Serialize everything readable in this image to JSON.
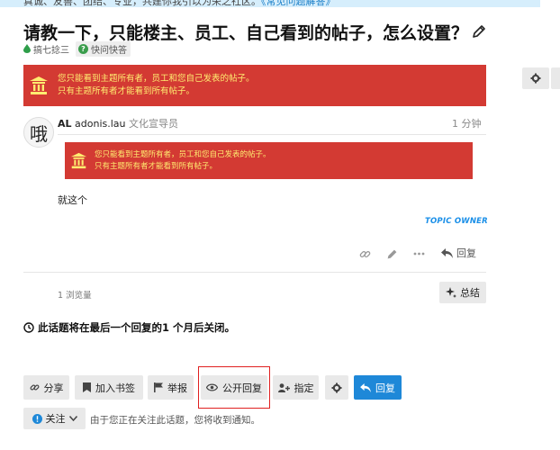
{
  "top_notice": {
    "text": "真诚、友善、团结、专业，共建你我引以为荣之社区。",
    "link": "《常见问题解答》"
  },
  "topic": {
    "title": "请教一下，只能楼主、员工、自己看到的帖子，怎么设置？",
    "category": "搞七捻三",
    "tag": "快问快答"
  },
  "banner": {
    "line1": "您只能看到主题所有者，员工和您自己发表的帖子。",
    "line2": "只有主题所有者才能看到所有帖子。"
  },
  "post": {
    "avatar_text": "哦",
    "username": "AL",
    "fullname": "adonis.lau",
    "user_title": "文化宣导员",
    "time": "1 分钟",
    "body": "就这个",
    "owner_label": "TOPIC OWNER",
    "reply_label": "回复"
  },
  "stats": {
    "views": "1 浏览量",
    "summarize_label": "总结"
  },
  "closing_notice": "此话题将在最后一个回复的1 个月后关闭。",
  "footer_buttons": {
    "share": "分享",
    "bookmark": "加入书签",
    "flag": "举报",
    "public_reply": "公开回复",
    "assign": "指定",
    "reply": "回复"
  },
  "notifications": {
    "label": "关注",
    "text": "由于您正在关注此话题，您将收到通知。"
  },
  "colors": {
    "banner_bg": "#d33a33",
    "banner_text": "#ffec70",
    "primary": "#1e88d8",
    "highlight_box": "#e02020",
    "owner_label": "#1a8fe8"
  }
}
